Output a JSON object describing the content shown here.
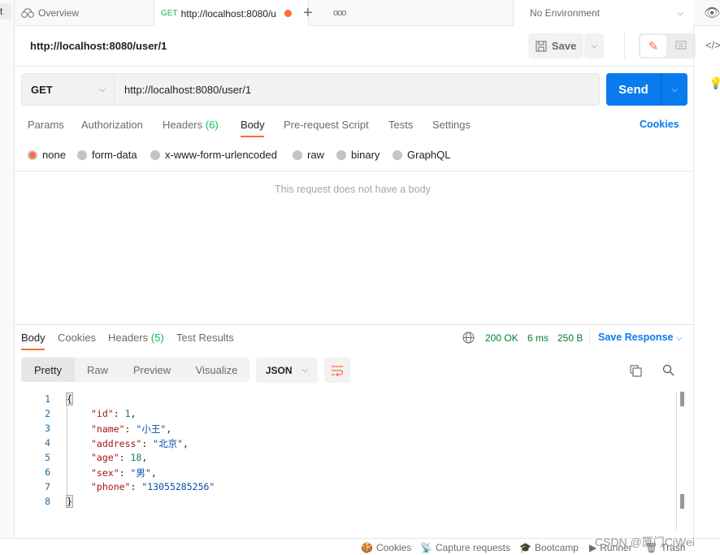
{
  "tabs": {
    "overview": "Overview",
    "active_method": "GET",
    "active_title": "http://localhost:8080/u",
    "environment": "No Environment"
  },
  "header": {
    "title": "http://localhost:8080/user/1",
    "save": "Save"
  },
  "request": {
    "method": "GET",
    "url": "http://localhost:8080/user/1",
    "send": "Send",
    "tabs": [
      {
        "label": "Params"
      },
      {
        "label": "Authorization"
      },
      {
        "label": "Headers",
        "count": "(6)"
      },
      {
        "label": "Body"
      },
      {
        "label": "Pre-request Script"
      },
      {
        "label": "Tests"
      },
      {
        "label": "Settings"
      }
    ],
    "cookies": "Cookies",
    "body_types": [
      "none",
      "form-data",
      "x-www-form-urlencoded",
      "raw",
      "binary",
      "GraphQL"
    ],
    "selected_body_type": "none",
    "empty_body": "This request does not have a body"
  },
  "response": {
    "tabs": [
      {
        "label": "Body"
      },
      {
        "label": "Cookies"
      },
      {
        "label": "Headers",
        "count": "(5)"
      },
      {
        "label": "Test Results"
      }
    ],
    "status": "200 OK",
    "time": "6 ms",
    "size": "250 B",
    "save_response": "Save Response",
    "views": [
      "Pretty",
      "Raw",
      "Preview",
      "Visualize"
    ],
    "format": "JSON",
    "lines": [
      "1",
      "2",
      "3",
      "4",
      "5",
      "6",
      "7",
      "8"
    ],
    "json": {
      "k1": "\"id\"",
      "v1": "1",
      "k2": "\"name\"",
      "v2": "\"小王\"",
      "k3": "\"address\"",
      "v3": "\"北京\"",
      "k4": "\"age\"",
      "v4": "18",
      "k5": "\"sex\"",
      "v5": "\"男\"",
      "k6": "\"phone\"",
      "v6": "\"13055285256\""
    }
  },
  "statusbar": {
    "cookies": "Cookies",
    "capture": "Capture requests",
    "bootcamp": "Bootcamp",
    "runner": "Runner",
    "trash": "Trash"
  },
  "watermark": "CSDN @厦门CiWei",
  "colors": {
    "accent": "#ff6c37",
    "send": "#097bed",
    "status_ok": "#007f31"
  }
}
